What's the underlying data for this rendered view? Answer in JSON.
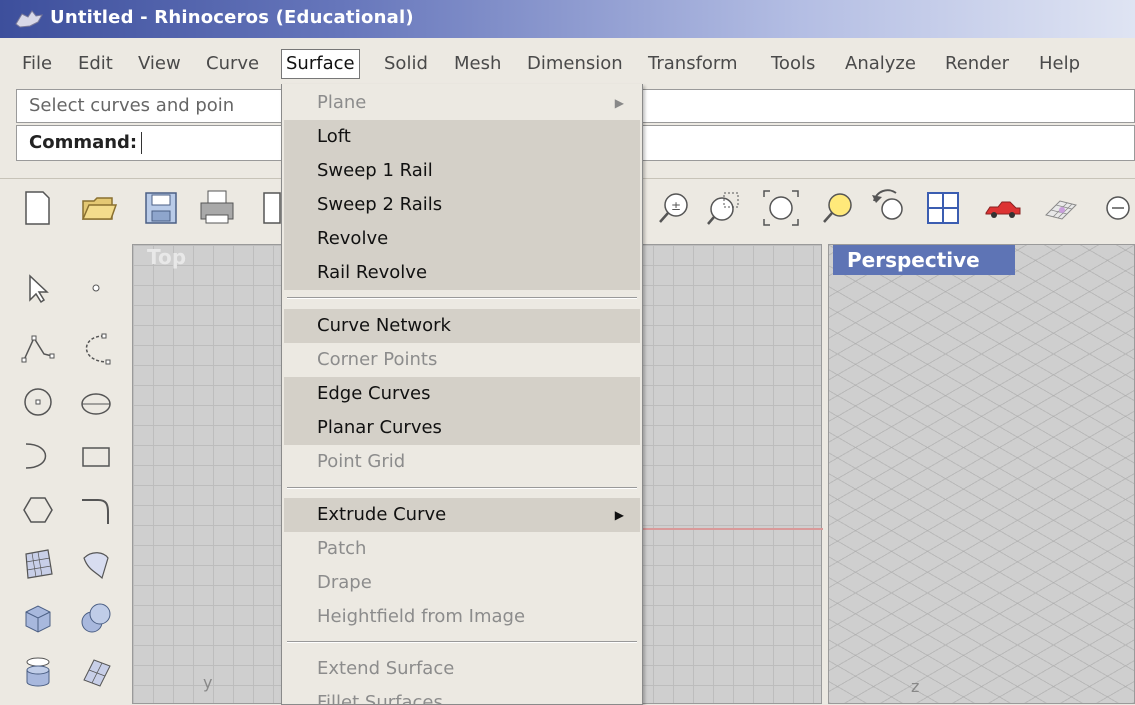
{
  "window": {
    "title": "Untitled - Rhinoceros (Educational)"
  },
  "menubar": [
    {
      "label": "File"
    },
    {
      "label": "Edit"
    },
    {
      "label": "View"
    },
    {
      "label": "Curve"
    },
    {
      "label": "Surface",
      "active": true
    },
    {
      "label": "Solid"
    },
    {
      "label": "Mesh"
    },
    {
      "label": "Dimension"
    },
    {
      "label": "Transform"
    },
    {
      "label": "Tools"
    },
    {
      "label": "Analyze"
    },
    {
      "label": "Render"
    },
    {
      "label": "Help"
    }
  ],
  "command": {
    "history": "Select curves and poin",
    "prompt_label": "Command:",
    "value": ""
  },
  "toolbar_icons": [
    "new-file-icon",
    "open-folder-icon",
    "save-icon",
    "print-icon",
    "zoom-in-icon",
    "zoom-window-icon",
    "zoom-extents-icon",
    "zoom-target-icon",
    "undo-view-icon",
    "four-viewports-icon",
    "car-render-icon",
    "grid-icon"
  ],
  "viewports": {
    "top": {
      "label": "Top",
      "axis": "y"
    },
    "perspective": {
      "label": "Perspective",
      "axis": "z"
    }
  },
  "surface_menu": {
    "items": [
      {
        "label": "Plane",
        "state": "disabled",
        "submenu": true
      },
      {
        "label": "Loft",
        "state": "enabled"
      },
      {
        "label": "Sweep 1 Rail",
        "state": "enabled"
      },
      {
        "label": "Sweep 2 Rails",
        "state": "enabled"
      },
      {
        "label": "Revolve",
        "state": "enabled"
      },
      {
        "label": "Rail Revolve",
        "state": "enabled"
      },
      {
        "separator": true
      },
      {
        "label": "Curve Network",
        "state": "enabled"
      },
      {
        "label": "Corner Points",
        "state": "disabled"
      },
      {
        "label": "Edge Curves",
        "state": "enabled"
      },
      {
        "label": "Planar Curves",
        "state": "enabled"
      },
      {
        "label": "Point Grid",
        "state": "disabled"
      },
      {
        "separator": true
      },
      {
        "label": "Extrude Curve",
        "state": "enabled",
        "submenu": true
      },
      {
        "label": "Patch",
        "state": "disabled"
      },
      {
        "label": "Drape",
        "state": "disabled"
      },
      {
        "label": "Heightfield from Image",
        "state": "disabled"
      },
      {
        "separator": true
      },
      {
        "label": "Extend Surface",
        "state": "disabled"
      },
      {
        "label": "Fillet Surfaces",
        "state": "disabled"
      }
    ]
  }
}
